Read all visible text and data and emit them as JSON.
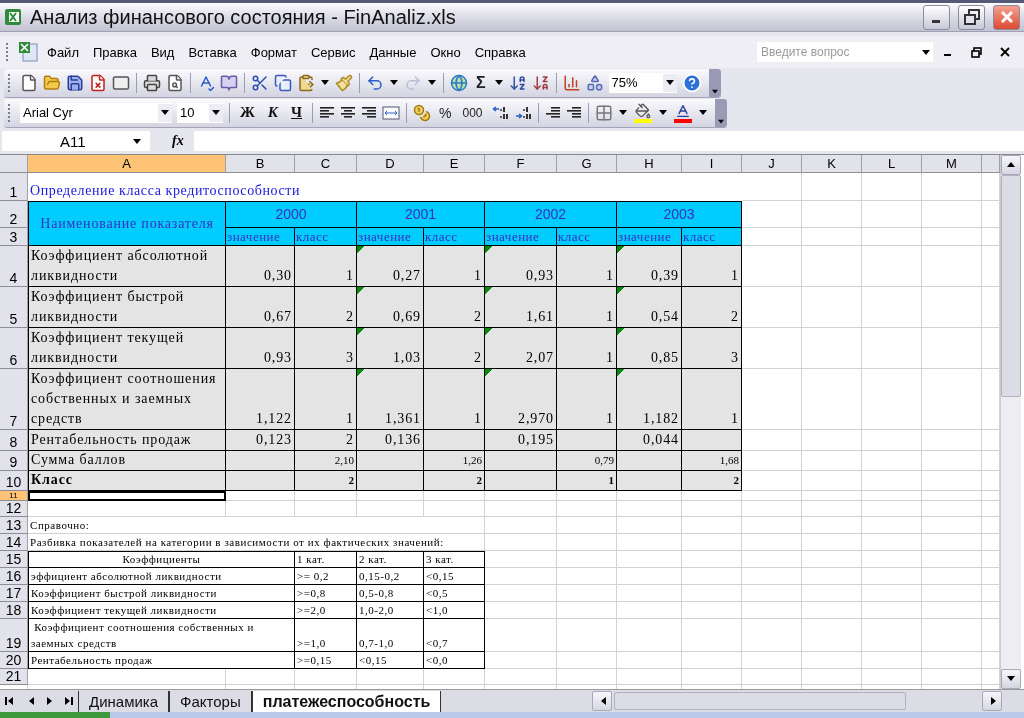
{
  "window": {
    "title": "Анализ финансового состояния - FinAnaliz.xls"
  },
  "menu": [
    {
      "label": "Файл"
    },
    {
      "label": "Правка"
    },
    {
      "label": "Вид"
    },
    {
      "label": "Вставка"
    },
    {
      "label": "Формат"
    },
    {
      "label": "Сервис"
    },
    {
      "label": "Данные"
    },
    {
      "label": "Окно"
    },
    {
      "label": "Справка"
    }
  ],
  "help_box": {
    "placeholder": "Введите вопрос"
  },
  "standard_toolbar": {
    "sum_label": "Σ",
    "zoom": "75%"
  },
  "formatting_toolbar": {
    "font": "Arial Cyr",
    "size": "10",
    "bold": "Ж",
    "italic": "К",
    "underline": "Ч",
    "percent": "%",
    "thousands": "000"
  },
  "formula_bar": {
    "name_box": "A11",
    "function_label": "fx"
  },
  "sheet": {
    "columns": [
      {
        "label": "A",
        "selected": true
      },
      {
        "label": "B",
        "selected": false
      },
      {
        "label": "C",
        "selected": false
      },
      {
        "label": "D",
        "selected": false
      },
      {
        "label": "E",
        "selected": false
      },
      {
        "label": "F",
        "selected": false
      },
      {
        "label": "G",
        "selected": false
      },
      {
        "label": "H",
        "selected": false
      },
      {
        "label": "I",
        "selected": false
      },
      {
        "label": "J",
        "selected": false
      },
      {
        "label": "K",
        "selected": false
      },
      {
        "label": "L",
        "selected": false
      },
      {
        "label": "M",
        "selected": false
      }
    ],
    "rows": [
      {
        "label": "1",
        "kind": "title",
        "selected": false,
        "cells": [
          {
            "text": "Определение класса кредитоспособности"
          }
        ]
      },
      {
        "label": "2",
        "kind": "year_header",
        "selected": false,
        "cells": [
          {
            "text": "Наименование показателя"
          },
          {
            "text": "2000"
          },
          {
            "text": "2001"
          },
          {
            "text": "2002"
          },
          {
            "text": "2003"
          }
        ]
      },
      {
        "label": "3",
        "kind": "sub_header",
        "selected": false,
        "cells": [
          {},
          {
            "text": "значение"
          },
          {
            "text": "класс"
          },
          {
            "text": "значение"
          },
          {
            "text": "класс"
          },
          {
            "text": "значение"
          },
          {
            "text": "класс"
          },
          {
            "text": "значение"
          },
          {
            "text": "класс"
          }
        ]
      },
      {
        "label": "4",
        "kind": "metric",
        "selected": false,
        "cells": [
          {
            "text": "Коэффициент абсолютной ликвидности"
          },
          {
            "text": "0,30",
            "flagged": false
          },
          {
            "text": "1",
            "flagged": false
          },
          {
            "text": "0,27",
            "flagged": true
          },
          {
            "text": "1",
            "flagged": false
          },
          {
            "text": "0,93",
            "flagged": true
          },
          {
            "text": "1",
            "flagged": false
          },
          {
            "text": "0,39",
            "flagged": true
          },
          {
            "text": "1",
            "flagged": false
          }
        ]
      },
      {
        "label": "5",
        "kind": "metric",
        "selected": false,
        "cells": [
          {
            "text": "Коэффициент быстрой ликвидности"
          },
          {
            "text": "0,67",
            "flagged": false
          },
          {
            "text": "2",
            "flagged": false
          },
          {
            "text": "0,69",
            "flagged": true
          },
          {
            "text": "2",
            "flagged": false
          },
          {
            "text": "1,61",
            "flagged": true
          },
          {
            "text": "1",
            "flagged": false
          },
          {
            "text": "0,54",
            "flagged": true
          },
          {
            "text": "2",
            "flagged": false
          }
        ]
      },
      {
        "label": "6",
        "kind": "metric",
        "selected": false,
        "cells": [
          {
            "text": "Коэффициент текущей ликвидности"
          },
          {
            "text": "0,93",
            "flagged": false
          },
          {
            "text": "3",
            "flagged": false
          },
          {
            "text": "1,03",
            "flagged": true
          },
          {
            "text": "2",
            "flagged": false
          },
          {
            "text": "2,07",
            "flagged": true
          },
          {
            "text": "1",
            "flagged": false
          },
          {
            "text": "0,85",
            "flagged": true
          },
          {
            "text": "3",
            "flagged": false
          }
        ]
      },
      {
        "label": "7",
        "kind": "metric",
        "selected": false,
        "cells": [
          {
            "text": "Коэффициент соотношения собственных и заемных средств"
          },
          {
            "text": "1,122",
            "flagged": false
          },
          {
            "text": "1",
            "flagged": false
          },
          {
            "text": "1,361",
            "flagged": true
          },
          {
            "text": "1",
            "flagged": false
          },
          {
            "text": "2,970",
            "flagged": true
          },
          {
            "text": "1",
            "flagged": false
          },
          {
            "text": "1,182",
            "flagged": true
          },
          {
            "text": "1",
            "flagged": false
          }
        ]
      },
      {
        "label": "8",
        "kind": "metric",
        "selected": false,
        "cells": [
          {
            "text": "Рентабельность продаж"
          },
          {
            "text": "0,123"
          },
          {
            "text": "2"
          },
          {
            "text": "0,136"
          },
          {},
          {
            "text": "0,195"
          },
          {},
          {
            "text": "0,044"
          },
          {}
        ]
      },
      {
        "label": "9",
        "kind": "score",
        "selected": false,
        "cells": [
          {
            "text": "Сумма баллов"
          },
          {},
          {
            "text": "2,10"
          },
          {},
          {
            "text": "1,26"
          },
          {},
          {
            "text": "0,79"
          },
          {},
          {
            "text": "1,68"
          }
        ]
      },
      {
        "label": "10",
        "kind": "class",
        "selected": false,
        "cells": [
          {
            "text": "Класс"
          },
          {},
          {
            "text": "2"
          },
          {},
          {
            "text": "2"
          },
          {},
          {
            "text": "1"
          },
          {},
          {
            "text": "2"
          }
        ]
      },
      {
        "label": "11",
        "kind": "thin",
        "selected": true,
        "cells": []
      },
      {
        "label": "12",
        "kind": "blank",
        "selected": false,
        "cells": []
      },
      {
        "label": "13",
        "kind": "note",
        "selected": false,
        "cells": [
          {
            "text": "Справочно:"
          }
        ]
      },
      {
        "label": "14",
        "kind": "note",
        "selected": false,
        "cells": [
          {
            "text": "Разбивка показателей на категории в зависимости от их фактических значений:"
          }
        ]
      },
      {
        "label": "15",
        "kind": "ref_header",
        "selected": false,
        "cells": [
          {
            "text": "Коэффициенты"
          },
          {
            "text": "1 кат."
          },
          {
            "text": "2 кат."
          },
          {
            "text": "3 кат."
          }
        ]
      },
      {
        "label": "16",
        "kind": "ref",
        "selected": false,
        "cells": [
          {
            "text": "эффициент абсолютной ликвидности"
          },
          {
            "text": ">= 0,2"
          },
          {
            "text": "0,15-0,2"
          },
          {
            "text": "<0,15"
          }
        ]
      },
      {
        "label": "17",
        "kind": "ref",
        "selected": false,
        "cells": [
          {
            "text": "Коэффициент быстрой ликвидности"
          },
          {
            "text": ">=0,8"
          },
          {
            "text": "0,5-0,8"
          },
          {
            "text": "<0,5"
          }
        ]
      },
      {
        "label": "18",
        "kind": "ref",
        "selected": false,
        "cells": [
          {
            "text": "Коэффициент текущей ликвидности"
          },
          {
            "text": ">=2,0"
          },
          {
            "text": "1,0-2,0"
          },
          {
            "text": "<1,0"
          }
        ]
      },
      {
        "label": "19",
        "kind": "ref",
        "selected": false,
        "cells": [
          {
            "text": " Коэффициент соотношения собственных и заемных средств"
          },
          {
            "text": ">=1,0"
          },
          {
            "text": "0,7-1,0"
          },
          {
            "text": "<0,7"
          }
        ]
      },
      {
        "label": "20",
        "kind": "ref",
        "selected": false,
        "cells": [
          {
            "text": "Рентабельность продаж"
          },
          {
            "text": ">=0,15"
          },
          {
            "text": "<0,15"
          },
          {
            "text": "<0,0"
          }
        ]
      },
      {
        "label": "21",
        "kind": "blank",
        "selected": false,
        "cells": []
      }
    ]
  },
  "sheet_tabs": [
    {
      "label": "Динамика",
      "selected": false
    },
    {
      "label": "Факторы",
      "selected": false
    },
    {
      "label": "платежеспособность",
      "selected": true
    }
  ]
}
